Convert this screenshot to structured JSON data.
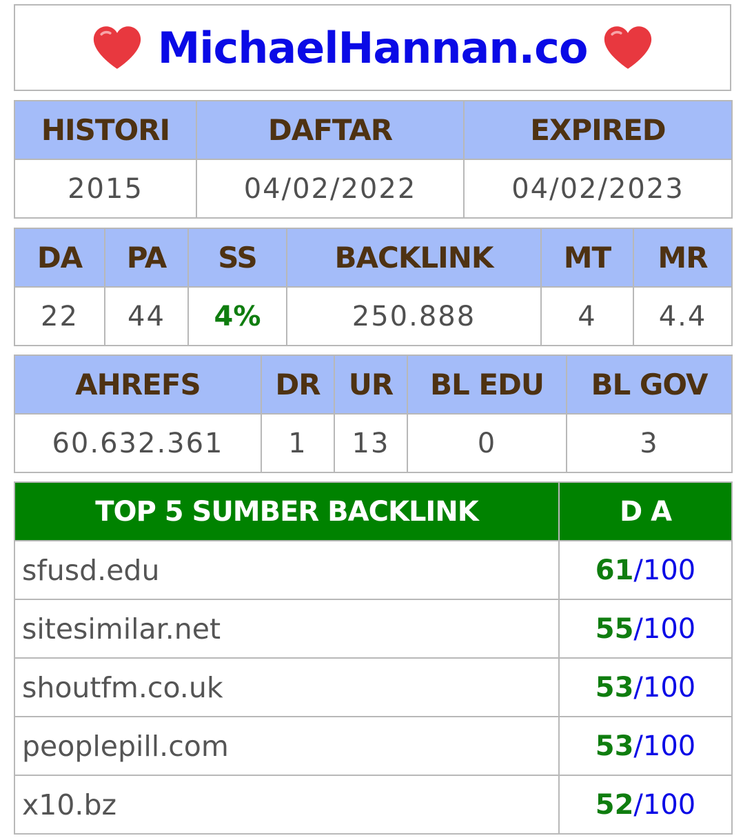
{
  "title": "MichaelHannan.co",
  "icons": {
    "left": "heart-icon",
    "right": "heart-icon"
  },
  "colors": {
    "header_bg": "#a4bcf9",
    "header_text": "#4e3212",
    "top5_header_bg": "#008200",
    "title": "#0a0ae6",
    "good": "#0f7d0f"
  },
  "domain_info": {
    "headers": [
      "HISTORI",
      "DAFTAR",
      "EXPIRED"
    ],
    "values": [
      "2015",
      "04/02/2022",
      "04/02/2023"
    ]
  },
  "moz": {
    "headers": [
      "DA",
      "PA",
      "SS",
      "BACKLINK",
      "MT",
      "MR"
    ],
    "values": [
      "22",
      "44",
      "4%",
      "250.888",
      "4",
      "4.4"
    ]
  },
  "ahrefs": {
    "headers": [
      "AHREFS",
      "DR",
      "UR",
      "BL EDU",
      "BL GOV"
    ],
    "values": [
      "60.632.361",
      "1",
      "13",
      "0",
      "3"
    ]
  },
  "top5": {
    "header_source": "TOP 5 SUMBER BACKLINK",
    "header_da": "D A",
    "max": "100",
    "rows": [
      {
        "domain": "sfusd.edu",
        "da": "61"
      },
      {
        "domain": "sitesimilar.net",
        "da": "55"
      },
      {
        "domain": "shoutfm.co.uk",
        "da": "53"
      },
      {
        "domain": "peoplepill.com",
        "da": "53"
      },
      {
        "domain": "x10.bz",
        "da": "52"
      }
    ]
  }
}
